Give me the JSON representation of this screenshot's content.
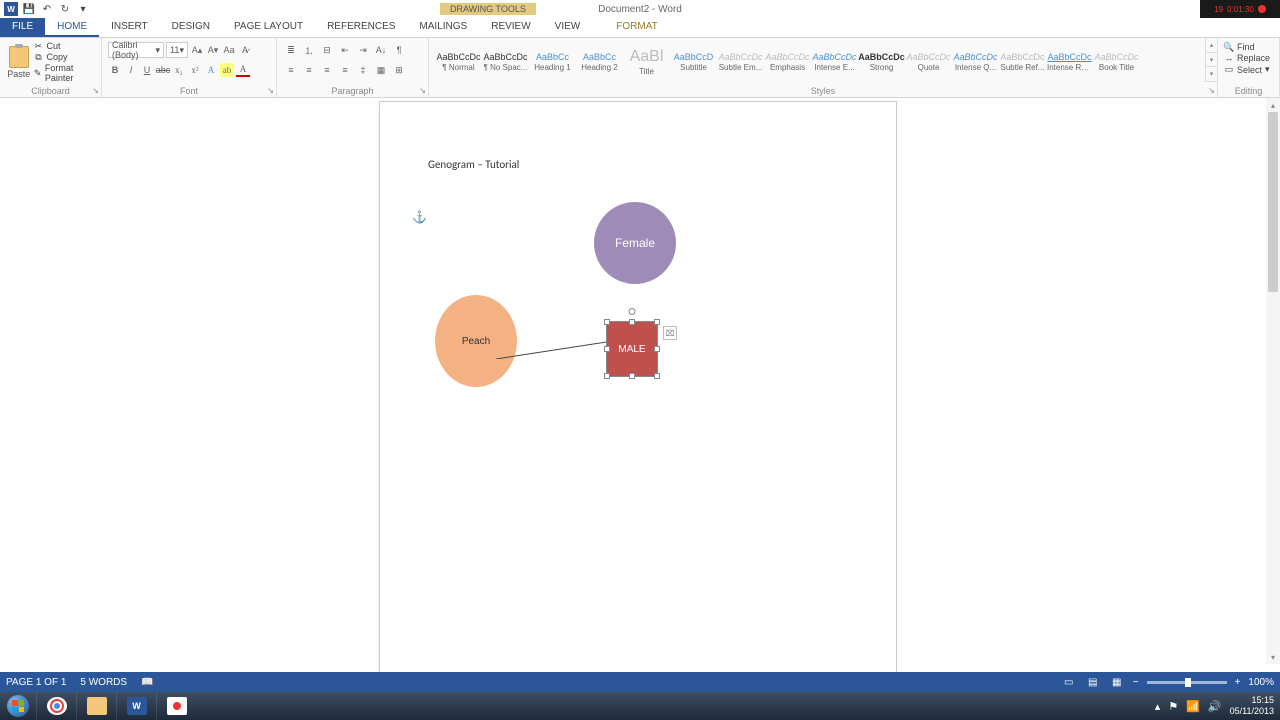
{
  "titlebar": {
    "doc_title": "Document2 - Word",
    "drawing_tools": "DRAWING TOOLS",
    "rec_time": "0:01:30",
    "rec_date": "19"
  },
  "tabs": {
    "file": "FILE",
    "home": "HOME",
    "insert": "INSERT",
    "design": "DESIGN",
    "page_layout": "PAGE LAYOUT",
    "references": "REFERENCES",
    "mailings": "MAILINGS",
    "review": "REVIEW",
    "view": "VIEW",
    "format": "FORMAT"
  },
  "clipboard": {
    "paste": "Paste",
    "cut": "Cut",
    "copy": "Copy",
    "format_painter": "Format Painter",
    "label": "Clipboard"
  },
  "font": {
    "name": "Calibri (Body)",
    "size": "11",
    "label": "Font"
  },
  "paragraph": {
    "label": "Paragraph"
  },
  "styles": {
    "label": "Styles",
    "items": [
      {
        "preview": "AaBbCcDc",
        "name": "¶ Normal",
        "cls": "dark"
      },
      {
        "preview": "AaBbCcDc",
        "name": "¶ No Spac...",
        "cls": "dark"
      },
      {
        "preview": "AaBbCc",
        "name": "Heading 1",
        "cls": "blue"
      },
      {
        "preview": "AaBbCc",
        "name": "Heading 2",
        "cls": "blue"
      },
      {
        "preview": "AaBl",
        "name": "Title",
        "cls": "big"
      },
      {
        "preview": "AaBbCcD",
        "name": "Subtitle",
        "cls": "blue"
      },
      {
        "preview": "AaBbCcDc",
        "name": "Subtle Em...",
        "cls": "italic"
      },
      {
        "preview": "AaBbCcDc",
        "name": "Emphasis",
        "cls": "italic"
      },
      {
        "preview": "AaBbCcDc",
        "name": "Intense E...",
        "cls": "blue italic"
      },
      {
        "preview": "AaBbCcDc",
        "name": "Strong",
        "cls": "dark bold"
      },
      {
        "preview": "AaBbCcDc",
        "name": "Quote",
        "cls": "italic"
      },
      {
        "preview": "AaBbCcDc",
        "name": "Intense Q...",
        "cls": "blue italic"
      },
      {
        "preview": "AaBbCcDc",
        "name": "Subtle Ref...",
        "cls": ""
      },
      {
        "preview": "AaBbCcDc",
        "name": "Intense Re...",
        "cls": "blue under"
      },
      {
        "preview": "AaBbCcDc",
        "name": "Book Title",
        "cls": "italic"
      }
    ]
  },
  "editing": {
    "find": "Find",
    "replace": "Replace",
    "select": "Select",
    "label": "Editing"
  },
  "document": {
    "heading": "Genogram – Tutorial",
    "female": "Female",
    "peach": "Peach",
    "male": "MALE"
  },
  "status": {
    "page": "PAGE 1 OF 1",
    "words": "5 WORDS",
    "zoom": "100%"
  },
  "taskbar": {
    "time": "15:15",
    "date": "05/11/2013"
  }
}
